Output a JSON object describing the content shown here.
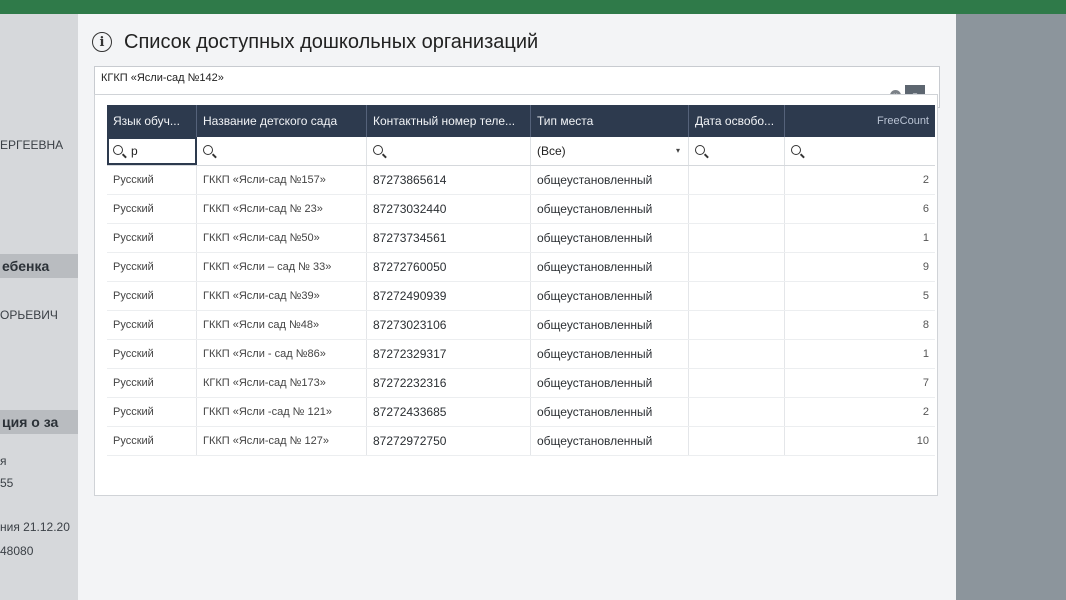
{
  "background": {
    "left_fragments": [
      "ЕРГЕЕВНА",
      "ебенка",
      "ОРЬЕВИЧ",
      "ция о за",
      "я",
      "55",
      "ния 21.12.20",
      "48080"
    ]
  },
  "dialog": {
    "title": "Список доступных дошкольных организаций",
    "info_icon": "info-icon",
    "combo": {
      "value": "КГКП «Ясли-сад №142»",
      "clear_icon": "×",
      "dropdown_icon": "▾"
    }
  },
  "grid": {
    "columns": [
      "Язык обуч...",
      "Название детского сада",
      "Контактный номер теле...",
      "Тип места",
      "Дата освобо...",
      "FreeCount"
    ],
    "filters": {
      "language_typed": "р",
      "place_type_selected": "(Все)",
      "caret": "▾"
    },
    "rows": [
      {
        "lang": "Русский",
        "name": "ГККП «Ясли-сад №157»",
        "phone": "87273865614",
        "type": "общеустановленный",
        "date": "",
        "free": "2"
      },
      {
        "lang": "Русский",
        "name": "ГККП «Ясли-сад № 23»",
        "phone": "87273032440",
        "type": "общеустановленный",
        "date": "",
        "free": "6"
      },
      {
        "lang": "Русский",
        "name": "ГККП «Ясли-сад №50»",
        "phone": "87273734561",
        "type": "общеустановленный",
        "date": "",
        "free": "1"
      },
      {
        "lang": "Русский",
        "name": "ГККП «Ясли – сад № 33»",
        "phone": "87272760050",
        "type": "общеустановленный",
        "date": "",
        "free": "9"
      },
      {
        "lang": "Русский",
        "name": "ГККП «Ясли-сад №39»",
        "phone": "87272490939",
        "type": "общеустановленный",
        "date": "",
        "free": "5"
      },
      {
        "lang": "Русский",
        "name": "ГККП «Ясли сад №48»",
        "phone": "87273023106",
        "type": "общеустановленный",
        "date": "",
        "free": "8"
      },
      {
        "lang": "Русский",
        "name": "ГККП «Ясли - сад №86»",
        "phone": "87272329317",
        "type": "общеустановленный",
        "date": "",
        "free": "1"
      },
      {
        "lang": "Русский",
        "name": "КГКП «Ясли-сад №173»",
        "phone": "87272232316",
        "type": "общеустановленный",
        "date": "",
        "free": "7"
      },
      {
        "lang": "Русский",
        "name": "ГККП «Ясли -сад № 121»",
        "phone": "87272433685",
        "type": "общеустановленный",
        "date": "",
        "free": "2"
      },
      {
        "lang": "Русский",
        "name": "ГККП «Ясли-сад № 127»",
        "phone": "87272972750",
        "type": "общеустановленный",
        "date": "",
        "free": "10"
      }
    ]
  },
  "colors": {
    "header_bg": "#2d3a4e",
    "top_strip": "#2f7a49"
  }
}
